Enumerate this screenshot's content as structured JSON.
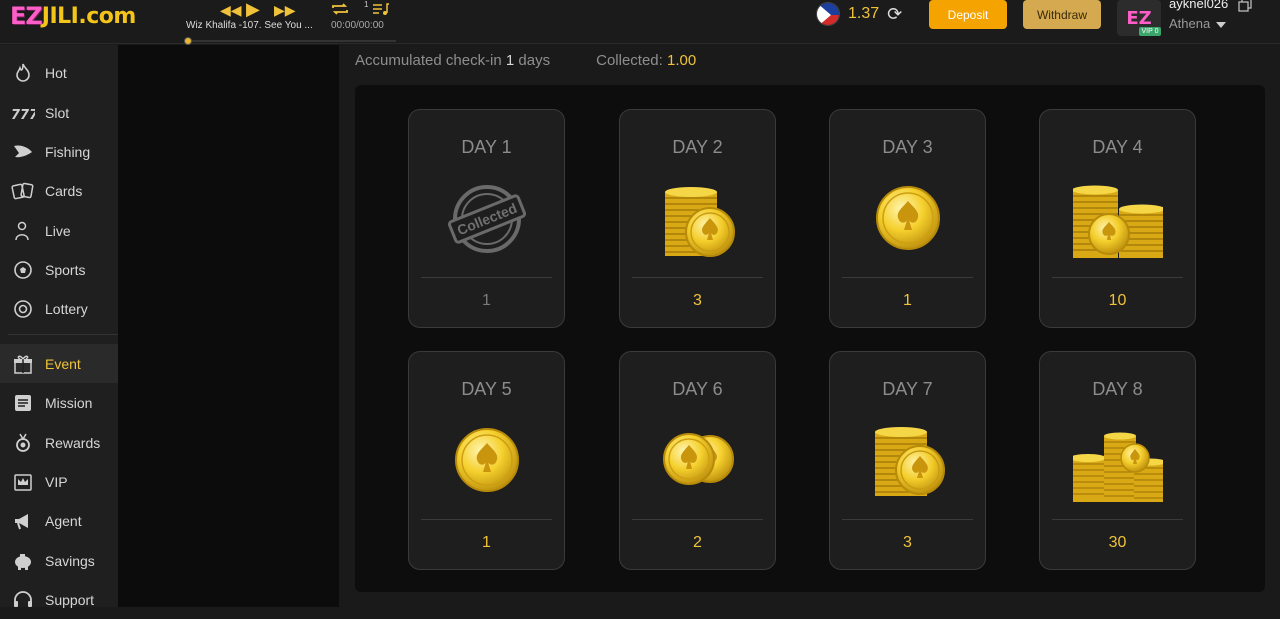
{
  "brand": {
    "logo_ez": "EZ",
    "logo_rest": "JILI.com"
  },
  "player": {
    "track_title": "Wiz Khalifa -107. See You ...",
    "time": "00:00/00:00",
    "repeat_count": "1",
    "progress": 0
  },
  "header": {
    "balance": "1.37",
    "deposit_label": "Deposit",
    "withdraw_label": "Withdraw",
    "avatar_text": "EZ",
    "vip_tag": "VIP 0",
    "username": "ayknel026",
    "display_name": "Athena"
  },
  "sidebar": {
    "items": [
      {
        "label": "Hot",
        "icon": "fire-icon",
        "active": false
      },
      {
        "label": "Slot",
        "icon": "slot-777-icon",
        "active": false
      },
      {
        "label": "Fishing",
        "icon": "fish-icon",
        "active": false
      },
      {
        "label": "Cards",
        "icon": "cards-icon",
        "active": false
      },
      {
        "label": "Live",
        "icon": "live-dealer-icon",
        "active": false
      },
      {
        "label": "Sports",
        "icon": "soccer-ball-icon",
        "active": false
      },
      {
        "label": "Lottery",
        "icon": "lottery-icon",
        "active": false
      },
      {
        "label": "Event",
        "icon": "gift-icon",
        "active": true
      },
      {
        "label": "Mission",
        "icon": "mission-list-icon",
        "active": false
      },
      {
        "label": "Rewards",
        "icon": "rewards-medal-icon",
        "active": false
      },
      {
        "label": "VIP",
        "icon": "vip-crown-icon",
        "active": false
      },
      {
        "label": "Agent",
        "icon": "megaphone-icon",
        "active": false
      },
      {
        "label": "Savings",
        "icon": "piggy-bank-icon",
        "active": false
      },
      {
        "label": "Support",
        "icon": "headset-icon",
        "active": false
      }
    ]
  },
  "checkin": {
    "accumulated_prefix": "Accumulated check-in",
    "accumulated_days": "1",
    "accumulated_suffix": "days",
    "collected_label": "Collected:",
    "collected_value": "1.00",
    "days": [
      {
        "label": "DAY 1",
        "amount": "1",
        "icon": "collected-stamp-icon",
        "stamp_text": "Collected"
      },
      {
        "label": "DAY 2",
        "amount": "3",
        "icon": "coin-stack-icon"
      },
      {
        "label": "DAY 3",
        "amount": "1",
        "icon": "single-coin-icon"
      },
      {
        "label": "DAY 4",
        "amount": "10",
        "icon": "coin-stacks-icon"
      },
      {
        "label": "DAY 5",
        "amount": "1",
        "icon": "single-coin-icon"
      },
      {
        "label": "DAY 6",
        "amount": "2",
        "icon": "two-coins-icon"
      },
      {
        "label": "DAY 7",
        "amount": "3",
        "icon": "coin-stack-icon"
      },
      {
        "label": "DAY 8",
        "amount": "30",
        "icon": "coin-pile-icon"
      }
    ]
  },
  "colors": {
    "accent_gold": "#f0c23a",
    "deposit": "#f5a300",
    "withdraw": "#d4a94f"
  }
}
